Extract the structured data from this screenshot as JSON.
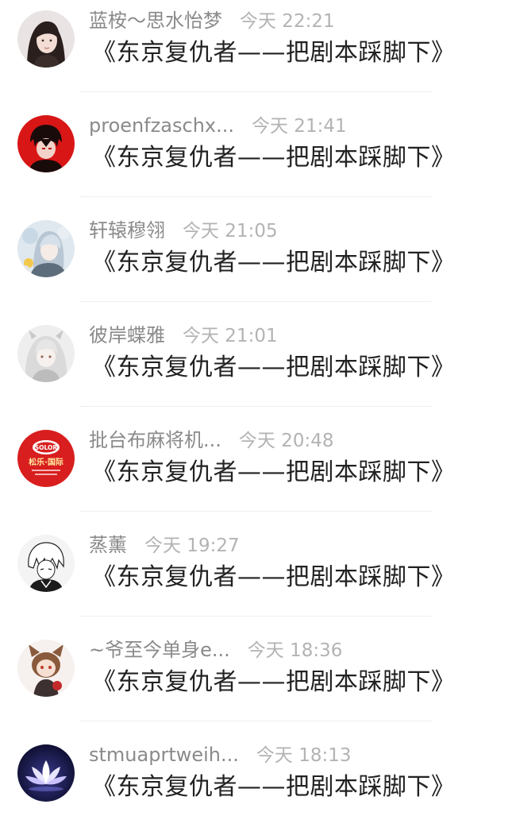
{
  "comments": [
    {
      "name": "蓝桉～思水怡梦",
      "time": "今天 22:21",
      "text": "《东京复仇者——把剧本踩脚下》",
      "avatar": "girl-portrait"
    },
    {
      "name": "proenfzaschx...",
      "time": "今天 21:41",
      "text": "《东京复仇者——把剧本踩脚下》",
      "avatar": "red-anime-boy"
    },
    {
      "name": "轩辕穆翎",
      "time": "今天 21:05",
      "text": "《东京复仇者——把剧本踩脚下》",
      "avatar": "silver-anime-character"
    },
    {
      "name": "彼岸蝶雅",
      "time": "今天 21:01",
      "text": "《东京复仇者——把剧本踩脚下》",
      "avatar": "white-hair-girl"
    },
    {
      "name": "批台布麻将机...",
      "time": "今天 20:48",
      "text": "《东京复仇者——把剧本踩脚下》",
      "avatar": "solor-logo"
    },
    {
      "name": "蒸薰",
      "time": "今天 19:27",
      "text": "《东京复仇者——把剧本踩脚下》",
      "avatar": "manga-boy-sketch"
    },
    {
      "name": "~爷至今单身e...",
      "time": "今天 18:36",
      "text": "《东京复仇者——把剧本踩脚下》",
      "avatar": "chibi-fox-character"
    },
    {
      "name": "stmuaprtweih...",
      "time": "今天 18:13",
      "text": "《东京复仇者——把剧本踩脚下》",
      "avatar": "lotus-flower"
    }
  ],
  "logo_text": {
    "solor": "SOLOR",
    "brand_cn": "松乐·国际"
  },
  "colors": {
    "name_gray": "#8a8a8a",
    "time_gray": "#b3b3b3",
    "text": "#222222",
    "divider": "#f0f0f0",
    "solor_red": "#d81e1e"
  }
}
